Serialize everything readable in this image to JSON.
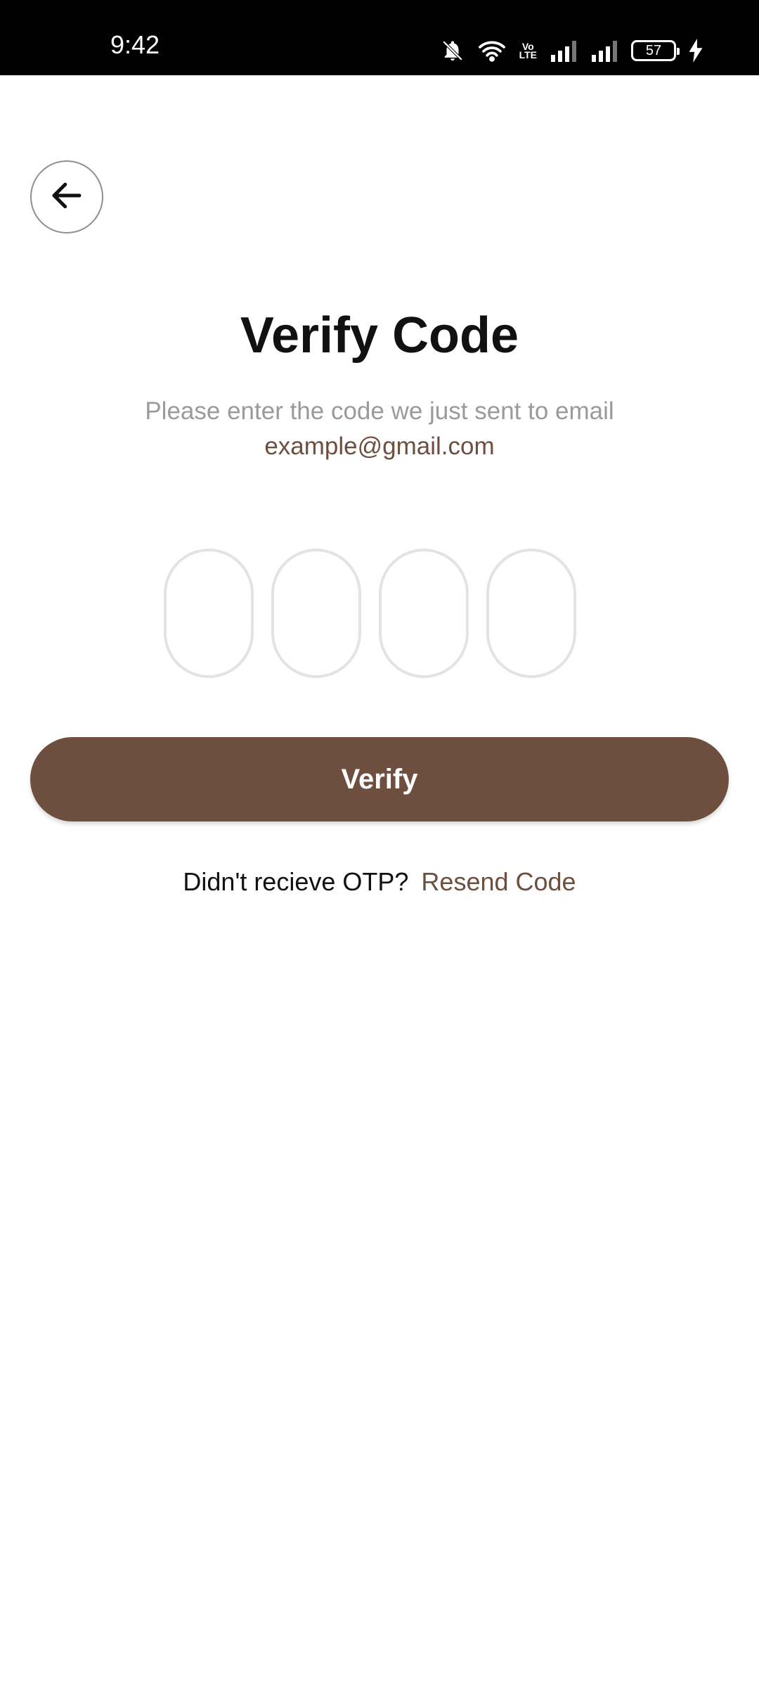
{
  "status_bar": {
    "time": "9:42",
    "battery": "57",
    "icons": [
      "bell-off-icon",
      "wifi-icon",
      "volte-icon",
      "signal-icon",
      "signal-icon",
      "battery-icon",
      "charging-icon"
    ],
    "volte_label": "Vo\nLTE"
  },
  "page": {
    "title": "Verify Code",
    "subtitle": "Please enter the code we just sent to email",
    "email": "example@gmail.com",
    "otp_values": [
      "",
      "",
      "",
      ""
    ],
    "verify_label": "Verify",
    "resend_prompt": "Didn't recieve OTP?",
    "resend_link": "Resend Code"
  },
  "colors": {
    "accent": "#6e4f3f",
    "muted_text": "#9a9a9a",
    "input_border": "#e3e3e3"
  }
}
